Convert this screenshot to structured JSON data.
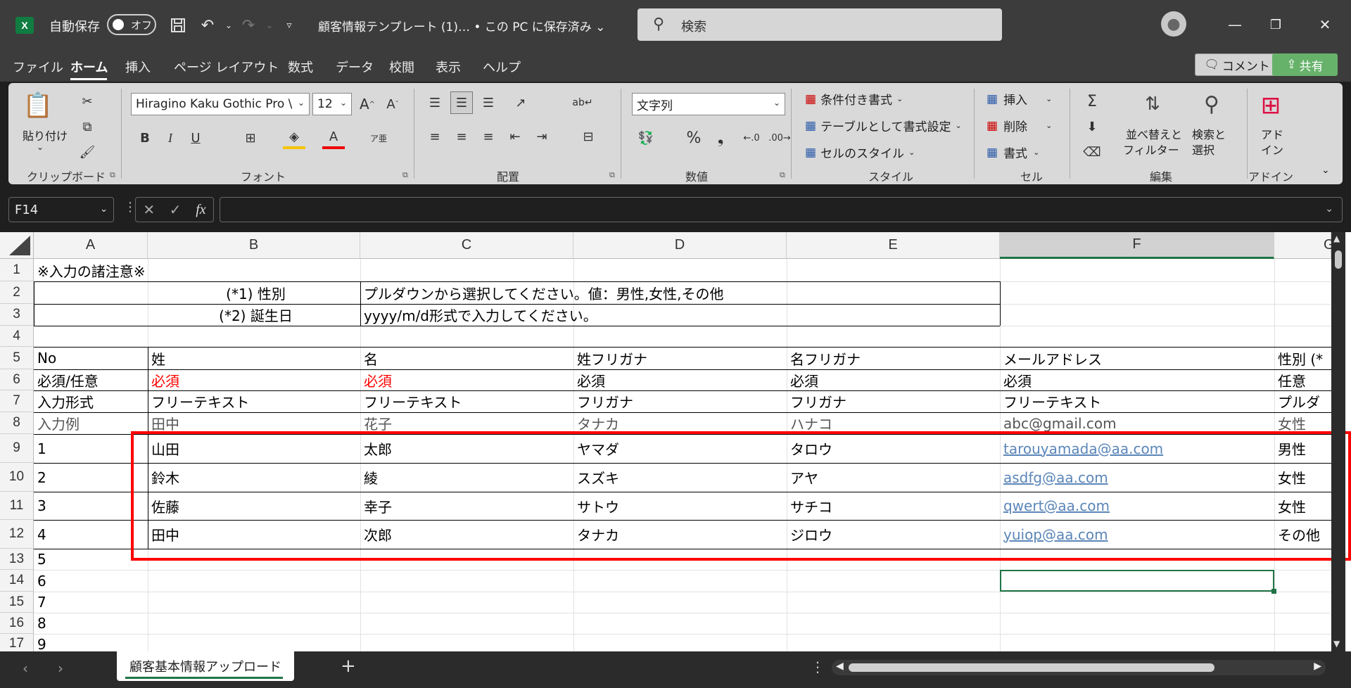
{
  "titlebar": {
    "app_logo": "X",
    "autosave_label": "自動保存",
    "autosave_state": "オフ",
    "doc_title": "顧客情報テンプレート (1)… • この PC に保存済み ⌄",
    "search_placeholder": "検索",
    "icons": [
      "save-icon",
      "undo-icon",
      "redo-icon",
      "customize-icon",
      "search-icon",
      "user-icon",
      "minimize-icon",
      "restore-icon",
      "close-icon"
    ]
  },
  "ribbon_tabs": [
    "ファイル",
    "ホーム",
    "挿入",
    "ページ レイアウト",
    "数式",
    "データ",
    "校閲",
    "表示",
    "ヘルプ"
  ],
  "comment_label": "コメント",
  "share_label": "共有",
  "ribbon": {
    "clipboard": {
      "label": "クリップボード",
      "paste": "貼り付け"
    },
    "font": {
      "label": "フォント",
      "name": "Hiragino Kaku Gothic Pro \\",
      "size": "12",
      "grow": "A^",
      "shrink": "Aˇ",
      "bold": "B",
      "italic": "I",
      "underline": "U",
      "color": "A",
      "phonetic": "ア亜"
    },
    "align": {
      "label": "配置"
    },
    "number": {
      "label": "数値",
      "format": "文字列",
      "percent": "%",
      "comma": "❟"
    },
    "styles": {
      "label": "スタイル",
      "conditional": "条件付き書式",
      "table": "テーブルとして書式設定",
      "cell_style": "セルのスタイル"
    },
    "cells": {
      "label": "セル",
      "insert": "挿入",
      "delete": "削除",
      "format": "書式"
    },
    "editing": {
      "label": "編集",
      "sort_line1": "並べ替えと",
      "sort_line2": "フィルター",
      "find_line1": "検索と",
      "find_line2": "選択"
    },
    "addins": {
      "label": "アドイン",
      "line1": "アド",
      "line2": "イン"
    }
  },
  "formula_bar": {
    "name_box": "F14",
    "fx": "fx",
    "content": ""
  },
  "columns": [
    "A",
    "B",
    "C",
    "D",
    "E",
    "F",
    "G"
  ],
  "rows": [
    "1",
    "2",
    "3",
    "4",
    "5",
    "6",
    "7",
    "8",
    "9",
    "10",
    "11",
    "12",
    "13",
    "14",
    "15",
    "16",
    "17"
  ],
  "selected_cell": "F14",
  "cells": {
    "a1": "※入力の諸注意※",
    "b2": "(*1) 性別",
    "c2": "プルダウンから選択してください。値：男性,女性,その他",
    "b3": "(*2) 誕生日",
    "c3": "yyyy/m/d形式で入力してください。",
    "table": [
      [
        "No",
        "姓",
        "名",
        "姓フリガナ",
        "名フリガナ",
        "メールアドレス",
        "性別 (*"
      ],
      [
        "必須/任意",
        "必須",
        "必須",
        "必須",
        "必須",
        "必須",
        "任意"
      ],
      [
        "入力形式",
        "フリーテキスト",
        "フリーテキスト",
        "フリガナ",
        "フリガナ",
        "フリーテキスト",
        "プルダ"
      ],
      [
        "入力例",
        "田中",
        "花子",
        "タナカ",
        "ハナコ",
        "abc@gmail.com",
        "女性"
      ],
      [
        "1",
        "山田",
        "太郎",
        "ヤマダ",
        "タロウ",
        "tarouyamada@aa.com",
        "男性"
      ],
      [
        "2",
        "鈴木",
        "綾",
        "スズキ",
        "アヤ",
        "asdfg@aa.com",
        "女性"
      ],
      [
        "3",
        "佐藤",
        "幸子",
        "サトウ",
        "サチコ",
        "qwert@aa.com",
        "女性"
      ],
      [
        "4",
        "田中",
        "次郎",
        "タナカ",
        "ジロウ",
        "yuiop@aa.com",
        "その他"
      ],
      [
        "5",
        "",
        "",
        "",
        "",
        "",
        ""
      ],
      [
        "6",
        "",
        "",
        "",
        "",
        "",
        ""
      ],
      [
        "7",
        "",
        "",
        "",
        "",
        "",
        ""
      ],
      [
        "8",
        "",
        "",
        "",
        "",
        "",
        ""
      ],
      [
        "9",
        "",
        "",
        "",
        "",
        "",
        ""
      ]
    ],
    "required_color": "#ff0000",
    "link_color": "#5b86b8"
  },
  "sheet_tab": "顧客基本情報アップロード",
  "colors": {
    "excel_green": "#217346",
    "highlight_red": "#ff0000",
    "share_green": "#67b26b"
  }
}
